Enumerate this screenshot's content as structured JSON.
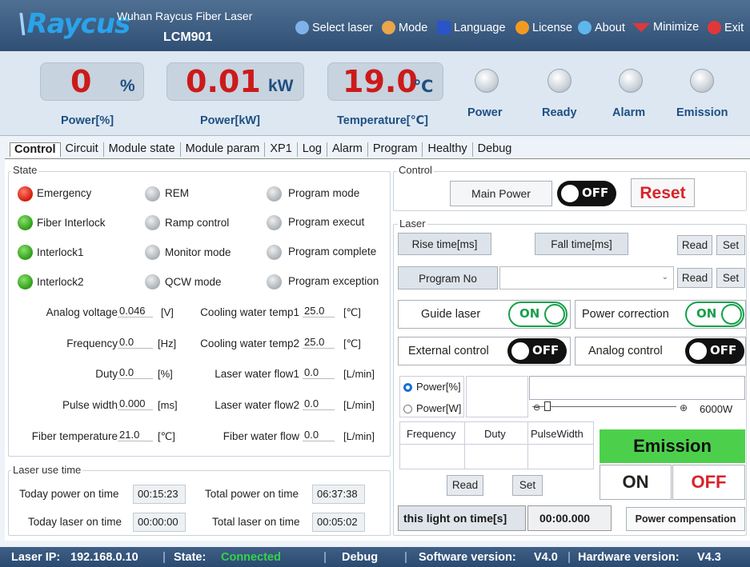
{
  "app": {
    "logo": "Raycus",
    "company": "Wuhan Raycus Fiber Laser",
    "model": "LCM901"
  },
  "menu": [
    {
      "label": "Select laser",
      "icon": "laser-select-icon",
      "color": "#7fb2e8"
    },
    {
      "label": "Mode",
      "icon": "users-icon",
      "color": "#e9a64a"
    },
    {
      "label": "Language",
      "icon": "language-icon",
      "color": "#2a55c8"
    },
    {
      "label": "License",
      "icon": "license-icon",
      "color": "#f39a21"
    },
    {
      "label": "About",
      "icon": "info-icon",
      "color": "#5fb6ea"
    },
    {
      "label": "Minimize",
      "icon": "minimize-icon",
      "color": "#e0383a"
    },
    {
      "label": "Exit",
      "icon": "close-icon",
      "color": "#e0383a"
    }
  ],
  "gauges": {
    "power_pct": {
      "value": "0",
      "unit": "%",
      "label": "Power[%]"
    },
    "power_kw": {
      "value": "0.01",
      "unit": "kW",
      "label": "Power[kW]"
    },
    "temp": {
      "value": "19.0",
      "unit": "℃",
      "label": "Temperature[℃]"
    }
  },
  "indicators": [
    "Power",
    "Ready",
    "Alarm",
    "Emission"
  ],
  "tabs": [
    "Control",
    "Circuit",
    "Module state",
    "Module param",
    "XP1",
    "Log",
    "Alarm",
    "Program",
    "Healthy",
    "Debug"
  ],
  "state": {
    "title": "State",
    "col1": [
      {
        "label": "Emergency",
        "status": "red"
      },
      {
        "label": "Fiber Interlock",
        "status": "green"
      },
      {
        "label": "Interlock1",
        "status": "green"
      },
      {
        "label": "Interlock2",
        "status": "green"
      }
    ],
    "col2": [
      {
        "label": "REM",
        "status": "gray"
      },
      {
        "label": "Ramp control",
        "status": "gray"
      },
      {
        "label": "Monitor mode",
        "status": "gray"
      },
      {
        "label": "QCW mode",
        "status": "gray"
      }
    ],
    "col3": [
      {
        "label": "Program mode",
        "status": "gray"
      },
      {
        "label": "Program execut",
        "status": "gray"
      },
      {
        "label": "Program complete",
        "status": "gray"
      },
      {
        "label": "Program exception",
        "status": "gray"
      }
    ],
    "params_left": [
      {
        "label": "Analog voltage",
        "value": "0.046",
        "unit": "[V]"
      },
      {
        "label": "Frequency",
        "value": "0.0",
        "unit": "[Hz]"
      },
      {
        "label": "Duty",
        "value": "0.0",
        "unit": "[%]"
      },
      {
        "label": "Pulse width",
        "value": "0.000",
        "unit": "[ms]"
      },
      {
        "label": "Fiber temperature",
        "value": "21.0",
        "unit": "[℃]"
      }
    ],
    "params_right": [
      {
        "label": "Cooling water temp1",
        "value": "25.0",
        "unit": "[℃]"
      },
      {
        "label": "Cooling water temp2",
        "value": "25.0",
        "unit": "[℃]"
      },
      {
        "label": "Laser water flow1",
        "value": "0.0",
        "unit": "[L/min]"
      },
      {
        "label": "Laser water flow2",
        "value": "0.0",
        "unit": "[L/min]"
      },
      {
        "label": "Fiber water flow",
        "value": "0.0",
        "unit": "[L/min]"
      }
    ]
  },
  "use_time": {
    "title": "Laser use time",
    "today_power_label": "Today power on time",
    "today_power": "00:15:23",
    "total_power_label": "Total power on time",
    "total_power": "06:37:38",
    "today_laser_label": "Today laser on time",
    "today_laser": "00:00:00",
    "total_laser_label": "Total laser on time",
    "total_laser": "00:05:02"
  },
  "control": {
    "title": "Control",
    "main_power": "Main Power",
    "main_power_state": "OFF",
    "reset": "Reset"
  },
  "laser": {
    "title": "Laser",
    "rise": "Rise time[ms]",
    "fall": "Fall time[ms]",
    "read": "Read",
    "set": "Set",
    "program_no": "Program No",
    "guide": "Guide laser",
    "guide_state": "ON",
    "power_corr": "Power correction",
    "power_corr_state": "ON",
    "external": "External control",
    "external_state": "OFF",
    "analog": "Analog control",
    "analog_state": "OFF",
    "radio_pct": "Power[%]",
    "radio_w": "Power[W]",
    "max_power": "6000W",
    "col_freq": "Frequency",
    "col_duty": "Duty",
    "col_pulse": "PulseWidth",
    "emission": "Emission",
    "on": "ON",
    "off": "OFF",
    "light_time_label": "this light on time[s]",
    "light_time": "00:00.000",
    "power_comp": "Power compensation"
  },
  "status": {
    "ip_label": "Laser IP:",
    "ip": "192.168.0.10",
    "state_label": "State:",
    "state": "Connected",
    "debug": "Debug",
    "sw_label": "Software version:",
    "sw": "V4.0",
    "hw_label": "Hardware version:",
    "hw": "V4.3",
    "state_color": "#35d24a"
  }
}
